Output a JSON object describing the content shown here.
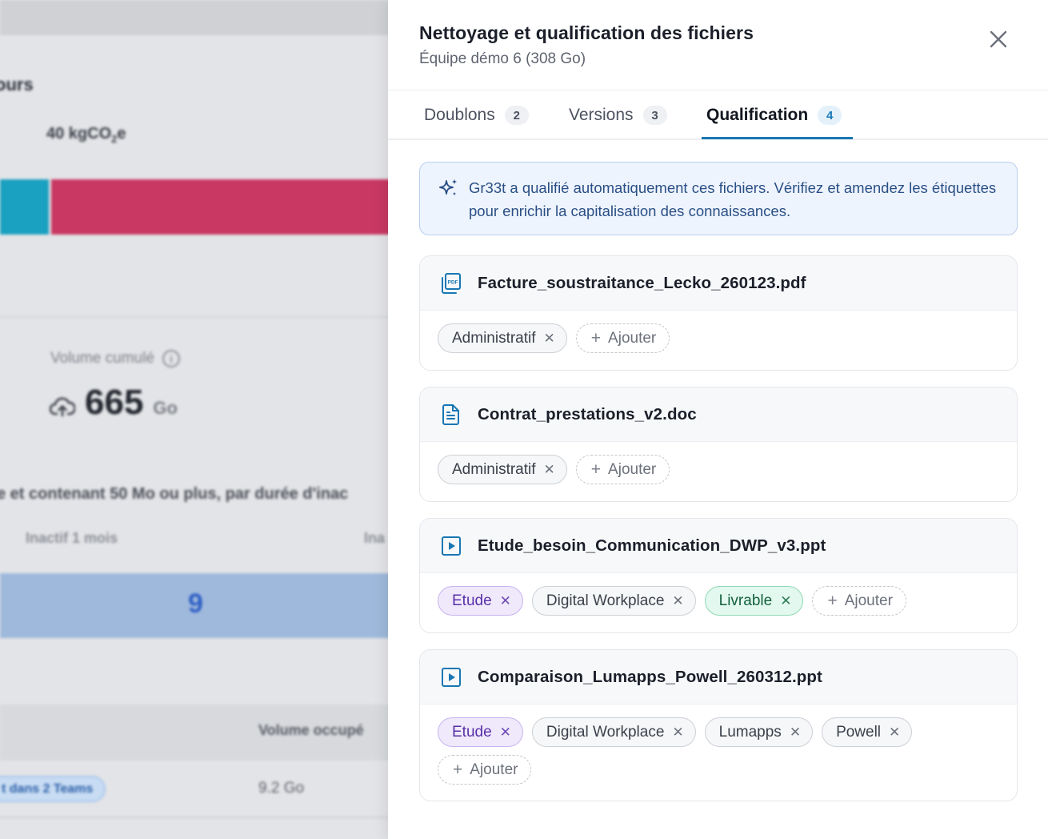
{
  "background": {
    "heading": "ours",
    "co2_prefix": "40 kgCO",
    "co2_sub": "2",
    "co2_suffix": "e",
    "volume_label": "Volume cumulé",
    "volume_value": "665",
    "volume_unit": "Go",
    "sentence": "e et contenant 50 Mo ou plus, par durée d'inac",
    "col_inactive_1": "Inactif 1 mois",
    "col_inactive_2": "Ina",
    "bar_count": "9",
    "table_col_volume": "Volume occupé",
    "row_chip": "t dans 2 Teams",
    "row_volume": "9.2 Go"
  },
  "panel": {
    "title": "Nettoyage et qualification des fichiers",
    "subtitle": "Équipe démo 6 (308 Go)",
    "tabs": [
      {
        "label": "Doublons",
        "count": "2"
      },
      {
        "label": "Versions",
        "count": "3"
      },
      {
        "label": "Qualification",
        "count": "4"
      }
    ],
    "info_text": "Gr33t a qualifié automatiquement ces fichiers. Vérifiez et amendez les étiquettes pour enrichir la capitalisation des connaissances.",
    "add_label": "Ajouter",
    "files": [
      {
        "name": "Facture_soustraitance_Lecko_260123.pdf",
        "icon": "pdf-icon",
        "tags": [
          {
            "label": "Administratif"
          }
        ]
      },
      {
        "name": "Contrat_prestations_v2.doc",
        "icon": "document-icon",
        "tags": [
          {
            "label": "Administratif"
          }
        ]
      },
      {
        "name": "Etude_besoin_Communication_DWP_v3.ppt",
        "icon": "presentation-icon",
        "tags": [
          {
            "label": "Etude"
          },
          {
            "label": "Digital Workplace"
          },
          {
            "label": "Livrable"
          }
        ]
      },
      {
        "name": "Comparaison_Lumapps_Powell_260312.ppt",
        "icon": "presentation-icon",
        "tags": [
          {
            "label": "Etude"
          },
          {
            "label": "Digital Workplace"
          },
          {
            "label": "Lumapps"
          },
          {
            "label": "Powell"
          }
        ]
      }
    ]
  },
  "colors": {
    "accent": "#1877b3",
    "info_bg": "#eef4fd",
    "tag_violet": "#5a2fa9",
    "tag_green": "#14613f",
    "bg_bar_teal": "#1aa0c0",
    "bg_bar_pink": "#c83862",
    "bg_bar_blue": "#9fb9dc"
  }
}
